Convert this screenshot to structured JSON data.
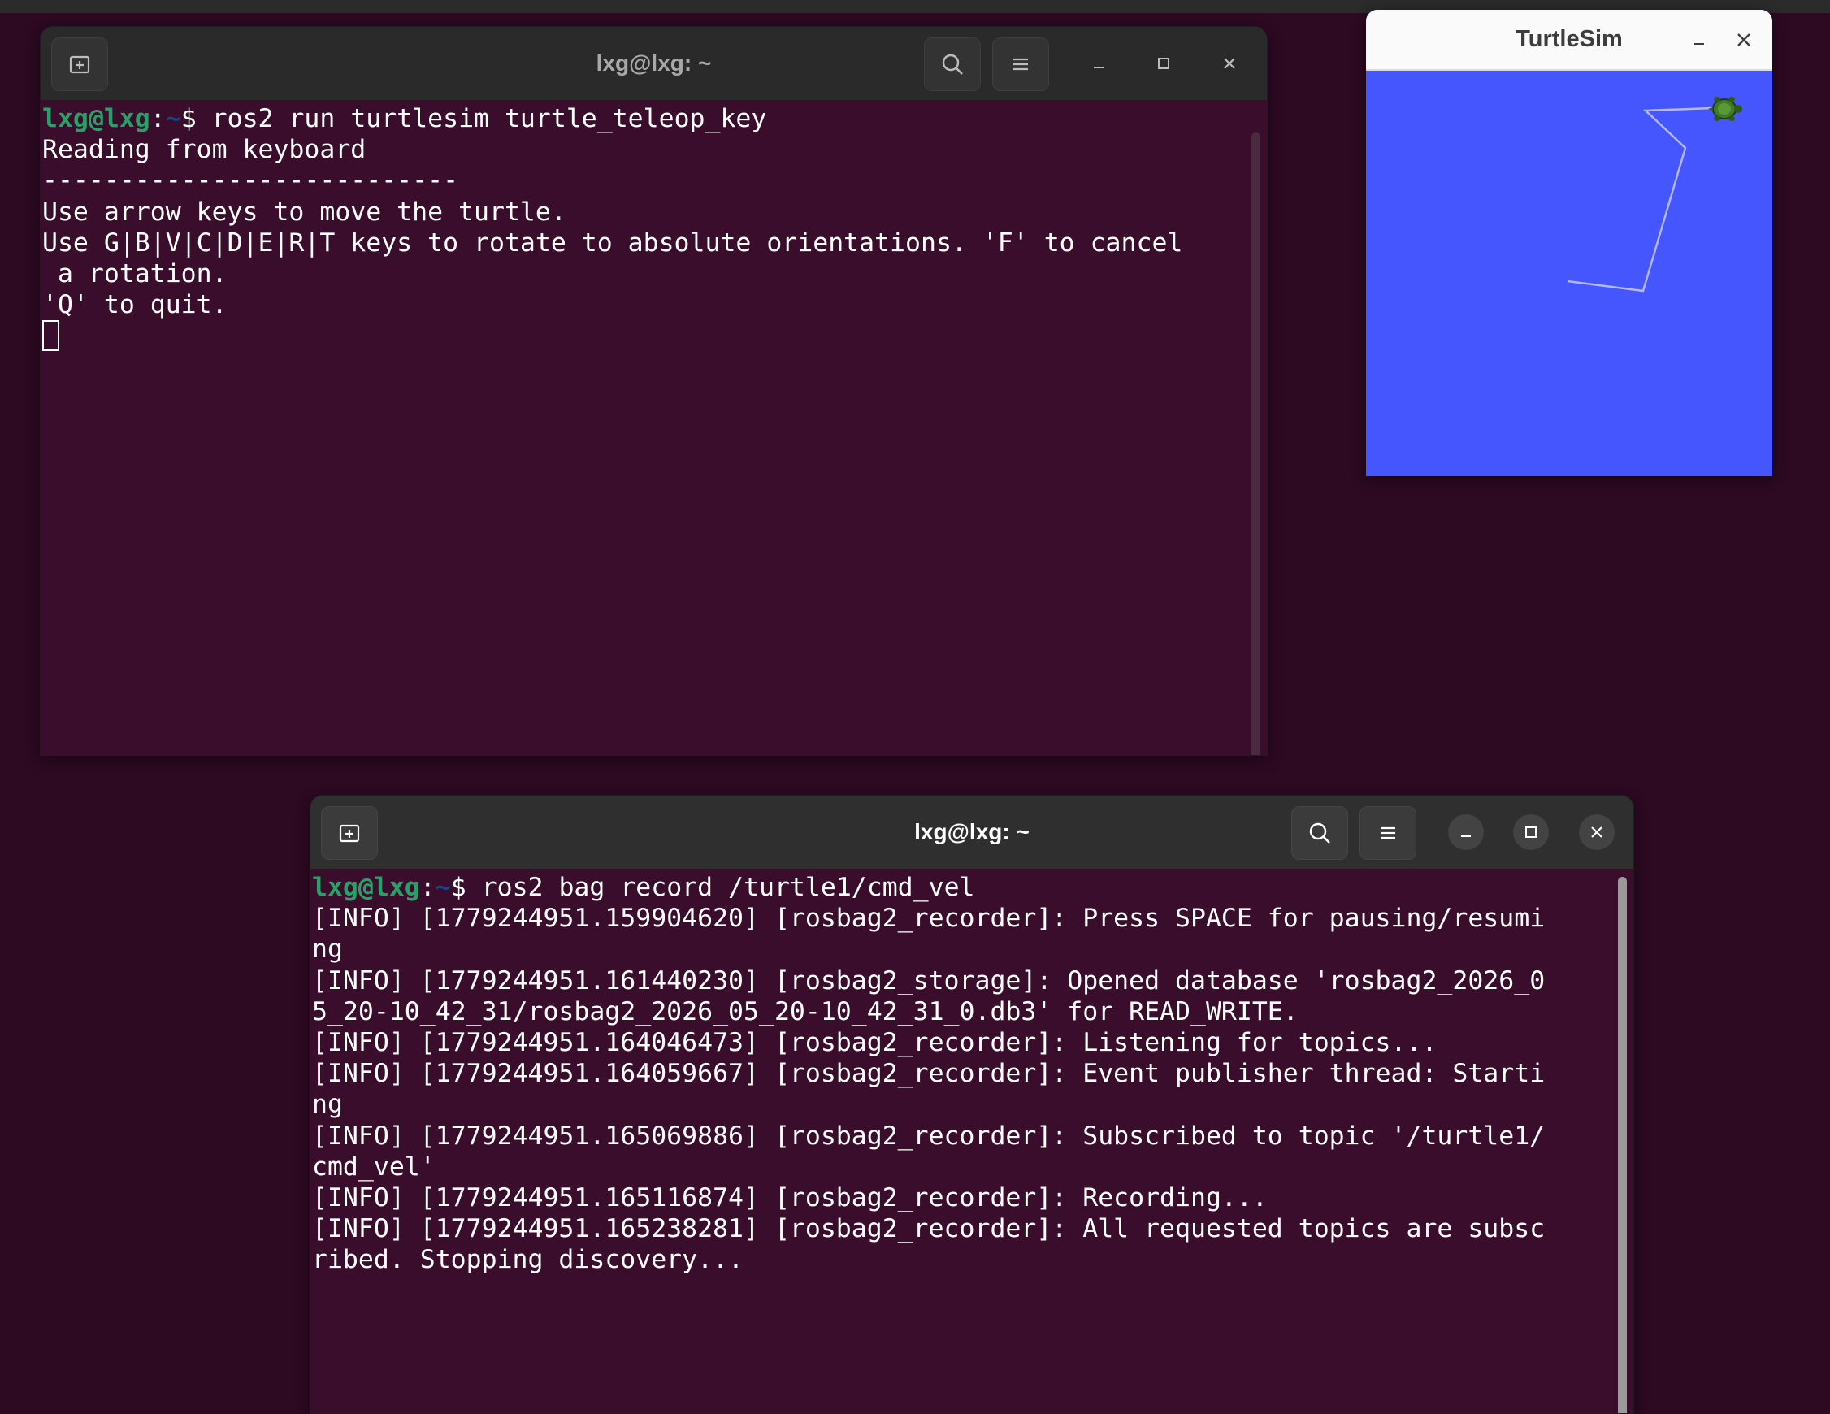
{
  "colors": {
    "desktop": "#2d0922",
    "terminal_bg": "#3b0d2c",
    "prompt_user": "#26a269",
    "prompt_path": "#12488b",
    "turtlesim_bg": "#4556ff",
    "trail": "#b3b8ff"
  },
  "terminal1": {
    "title": "lxg@lxg: ~",
    "icons": [
      "new-tab-icon",
      "search-icon",
      "hamburger-menu-icon",
      "minimize-icon",
      "maximize-icon",
      "close-icon"
    ],
    "prompt": {
      "user": "lxg@lxg",
      "sep": ":",
      "path": "~",
      "sym": "$ ",
      "command": "ros2 run turtlesim turtle_teleop_key"
    },
    "lines": [
      "Reading from keyboard",
      "---------------------------",
      "Use arrow keys to move the turtle.",
      "Use G|B|V|C|D|E|R|T keys to rotate to absolute orientations. 'F' to cancel",
      " a rotation.",
      "'Q' to quit."
    ]
  },
  "terminal2": {
    "title": "lxg@lxg: ~",
    "icons": [
      "new-tab-icon",
      "search-icon",
      "hamburger-menu-icon",
      "minimize-icon",
      "maximize-icon",
      "close-icon"
    ],
    "prompt": {
      "user": "lxg@lxg",
      "sep": ":",
      "path": "~",
      "sym": "$ ",
      "command": "ros2 bag record /turtle1/cmd_vel"
    },
    "lines": [
      "[INFO] [1779244951.159904620] [rosbag2_recorder]: Press SPACE for pausing/resumi",
      "ng",
      "[INFO] [1779244951.161440230] [rosbag2_storage]: Opened database 'rosbag2_2026_0",
      "5_20-10_42_31/rosbag2_2026_05_20-10_42_31_0.db3' for READ_WRITE.",
      "[INFO] [1779244951.164046473] [rosbag2_recorder]: Listening for topics...",
      "[INFO] [1779244951.164059667] [rosbag2_recorder]: Event publisher thread: Starti",
      "ng",
      "[INFO] [1779244951.165069886] [rosbag2_recorder]: Subscribed to topic '/turtle1/",
      "cmd_vel'",
      "[INFO] [1779244951.165116874] [rosbag2_recorder]: Recording...",
      "[INFO] [1779244951.165238281] [rosbag2_recorder]: All requested topics are subsc",
      "ribed. Stopping discovery..."
    ]
  },
  "turtlesim": {
    "title": "TurtleSim",
    "icons": [
      "minimize-icon",
      "close-icon",
      "turtle-icon"
    ]
  }
}
